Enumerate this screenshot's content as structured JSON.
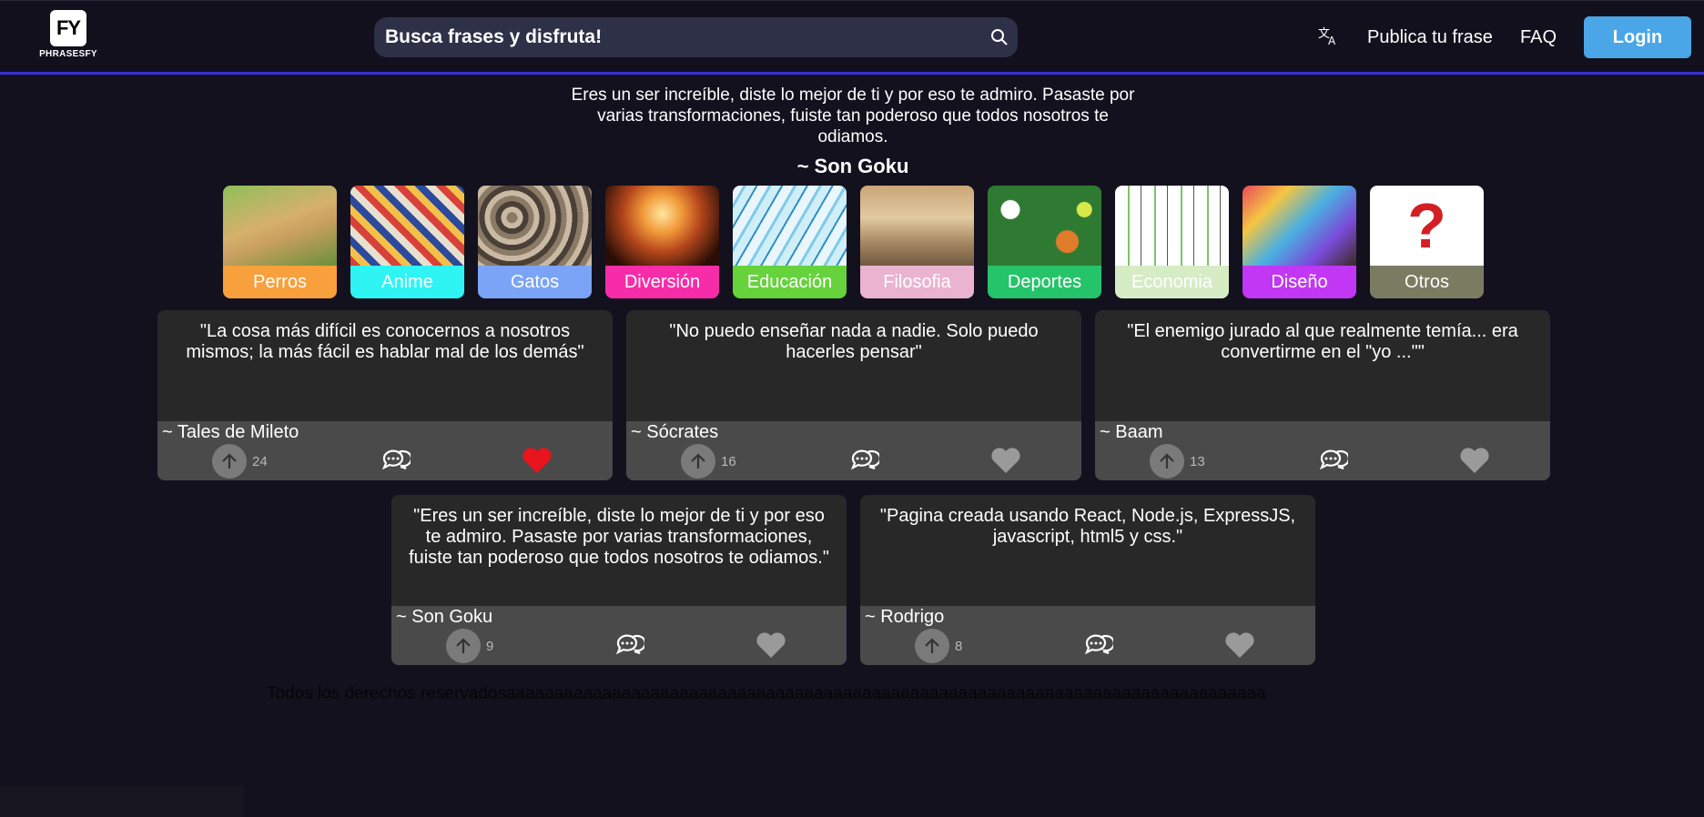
{
  "header": {
    "logo_mark": "FY",
    "logo_text": "PHRASESFY",
    "search_placeholder": "Busca frases y disfruta!",
    "publish_label": "Publica tu frase",
    "faq_label": "FAQ",
    "login_label": "Login",
    "translate_icon": "translate-icon"
  },
  "featured": {
    "quote": "Eres un ser increíble, diste lo mejor de ti y por eso te admiro. Pasaste por varias transformaciones, fuiste tan poderoso que todos nosotros te odiamos.",
    "author": "~ Son Goku"
  },
  "categories": [
    {
      "label": "Perros",
      "color": "#f7a03c"
    },
    {
      "label": "Anime",
      "color": "#2ef4f4"
    },
    {
      "label": "Gatos",
      "color": "#7ba4f6"
    },
    {
      "label": "Diversión",
      "color": "#f72ca8"
    },
    {
      "label": "Educación",
      "color": "#66d23c"
    },
    {
      "label": "Filosofia",
      "color": "#eab3cf"
    },
    {
      "label": "Deportes",
      "color": "#25c46b"
    },
    {
      "label": "Economia",
      "color": "#d6ecc5"
    },
    {
      "label": "Diseño",
      "color": "#c137f3"
    },
    {
      "label": "Otros",
      "color": "#7a7c62"
    }
  ],
  "cards": [
    {
      "quote": "\"La cosa más difícil es conocernos a nosotros mismos; la más fácil es hablar mal de los demás\"",
      "author": "~ Tales de Mileto",
      "votes": "24",
      "liked": true
    },
    {
      "quote": "\"No puedo enseñar nada a nadie. Solo puedo hacerles pensar\"",
      "author": "~ Sócrates",
      "votes": "16",
      "liked": false
    },
    {
      "quote": "\"El enemigo jurado al que realmente temía... era convertirme en el \"yo ...\"\"",
      "author": "~ Baam",
      "votes": "13",
      "liked": false
    },
    {
      "quote": "\"Eres un ser increíble, diste lo mejor de ti y por eso te admiro. Pasaste por varias transformaciones, fuiste tan poderoso que todos nosotros te odiamos.\"",
      "author": "~ Son Goku",
      "votes": "9",
      "liked": false
    },
    {
      "quote": "\"Pagina creada usando React, Node.js, ExpressJS, javascript, html5 y css.\"",
      "author": "~ Rodrigo",
      "votes": "8",
      "liked": false
    }
  ],
  "footer": {
    "text": "Todos los derechos reservadosaaaaaaaaaaaaaaaaaaaaaaaaaaaaaaaaaaaaaaaaaaaaaaaaaaaaaaaaaaaaaaaaaaaaaaaaaaaaaaa"
  },
  "colors": {
    "accent_line": "#3b2fd6",
    "login_bg": "#4aa6e6",
    "heart_liked": "#e8141e",
    "heart_default": "#9a9a9a"
  }
}
